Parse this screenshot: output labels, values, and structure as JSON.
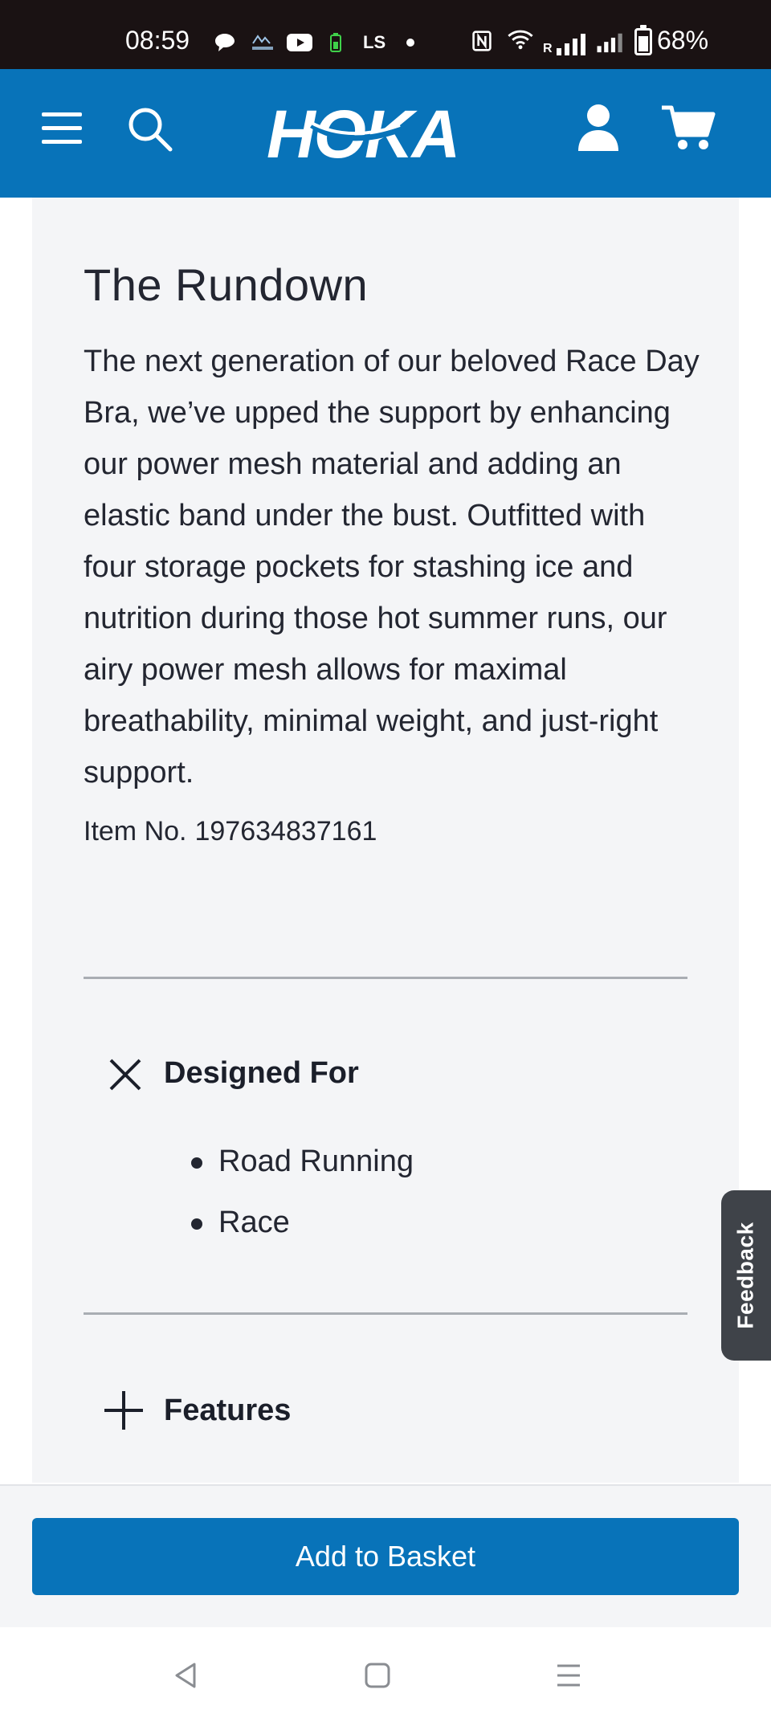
{
  "status_bar": {
    "time": "08:59",
    "battery_percent": "68%",
    "battery_level": 0.68,
    "icons": [
      "chat-bubble-icon",
      "avarn-app-icon",
      "youtube-icon",
      "battery-saver-icon",
      "ls-app-icon",
      "dot-icon",
      "nfc-icon",
      "wifi-icon",
      "signal-roaming-icon",
      "signal-icon"
    ],
    "ls_label": "LS",
    "roaming_label": "R"
  },
  "header": {
    "brand": "HOKA",
    "background_color": "#0873b9",
    "icons": [
      "menu-icon",
      "search-icon",
      "account-icon",
      "cart-icon"
    ]
  },
  "product": {
    "section_title": "The Rundown",
    "description": "The next generation of our beloved Race Day Bra, we’ve upped the support by enhancing our power mesh material and adding an elastic band under the bust. Outfitted with four storage pockets for stashing ice and nutrition during those hot summer runs, our airy power mesh allows for maximal breathability, minimal weight, and just-right support.",
    "item_label": "Item No.",
    "item_number": "197634837161"
  },
  "accordions": [
    {
      "label": "Designed For",
      "expanded": true,
      "icon": "close-icon",
      "items": [
        "Road Running",
        "Race"
      ]
    },
    {
      "label": "Features",
      "expanded": false,
      "icon": "plus-icon"
    }
  ],
  "feedback_tab": {
    "label": "Feedback"
  },
  "cta": {
    "label": "Add to Basket",
    "color": "#0873b9"
  },
  "navbar": {
    "icons": [
      "back-icon",
      "home-icon",
      "recents-icon"
    ]
  }
}
